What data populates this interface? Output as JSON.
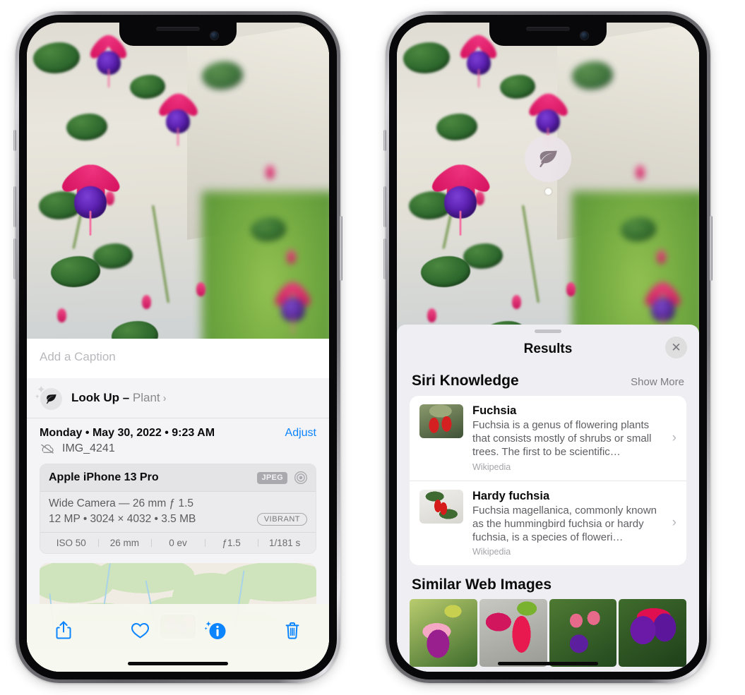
{
  "left_phone": {
    "photo": {
      "alt": "fuchsia-flowers-photo"
    },
    "caption": {
      "placeholder": "Add a Caption",
      "value": ""
    },
    "lookup": {
      "icon": "leaf-icon",
      "label": "Look Up –",
      "category": "Plant",
      "chevron": "›"
    },
    "meta": {
      "date": "Monday • May 30, 2022 • 9:23 AM",
      "adjust": "Adjust",
      "filename": "IMG_4241",
      "cloud_icon": "cloud-slash-icon"
    },
    "exif": {
      "model": "Apple iPhone 13 Pro",
      "format_badge": "JPEG",
      "aperture_icon": "aperture-icon",
      "lens": "Wide Camera — 26 mm ƒ 1.5",
      "details": "12 MP • 3024 × 4032 • 3.5 MB",
      "style_badge": "VIBRANT",
      "settings": [
        "ISO 50",
        "26 mm",
        "0 ev",
        "ƒ1.5",
        "1/181 s"
      ]
    },
    "map": {
      "pin": "photo-pin-thumbnail"
    },
    "toolbar": [
      {
        "name": "share-button",
        "icon": "share-icon"
      },
      {
        "name": "favorite-button",
        "icon": "heart-icon"
      },
      {
        "name": "info-button",
        "icon": "visual-lookup-info-icon"
      },
      {
        "name": "delete-button",
        "icon": "trash-icon"
      }
    ]
  },
  "right_phone": {
    "leaf_pin": {
      "icon": "leaf-icon"
    },
    "sheet": {
      "grabber": "sheet-grabber",
      "title": "Results",
      "close": "✕"
    },
    "siri_knowledge": {
      "heading": "Siri Knowledge",
      "show_more": "Show More",
      "items": [
        {
          "thumb": "fuchsia-thumbnail",
          "title": "Fuchsia",
          "description": "Fuchsia is a genus of flowering plants that consists mostly of shrubs or small trees. The first to be scientific…",
          "source": "Wikipedia",
          "chevron": "›"
        },
        {
          "thumb": "hardy-fuchsia-thumbnail",
          "title": "Hardy fuchsia",
          "description": "Fuchsia magellanica, commonly known as the hummingbird fuchsia or hardy fuchsia, is a species of floweri…",
          "source": "Wikipedia",
          "chevron": "›"
        }
      ]
    },
    "similar_web_images": {
      "heading": "Similar Web Images",
      "thumbs": [
        "web-image-1",
        "web-image-2",
        "web-image-3",
        "web-image-4"
      ]
    }
  },
  "colors": {
    "accent_blue": "#0a84ff",
    "sheet_gray": "#efeff3",
    "card_white": "#ffffff",
    "secondary_text": "#8a8a8e"
  }
}
